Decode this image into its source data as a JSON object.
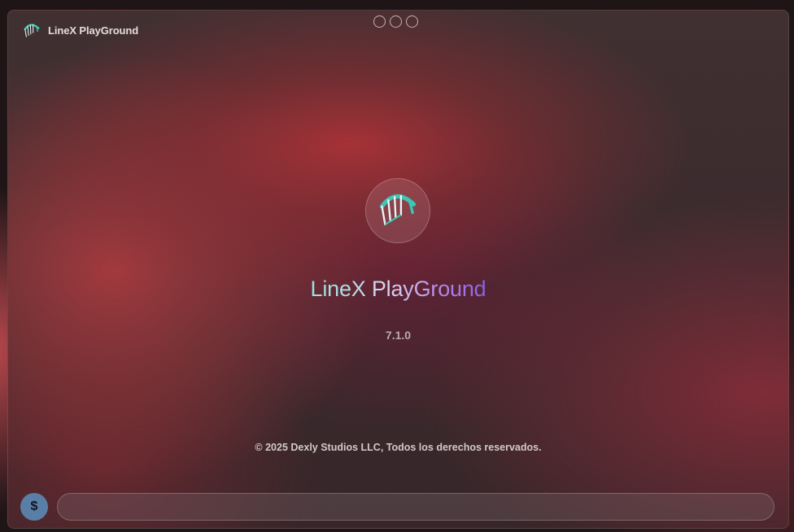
{
  "window": {
    "title": "LineX PlayGround",
    "controls": [
      "minimize",
      "maximize",
      "close"
    ]
  },
  "about": {
    "app_name": "LineX PlayGround",
    "version": "7.1.0",
    "copyright": "© 2025 Dexly Studios LLC, Todos los derechos reservados."
  },
  "bottom_bar": {
    "currency_symbol": "$",
    "input_value": "",
    "input_placeholder": ""
  },
  "icons": {
    "app_logo": "kite-logo-icon",
    "currency": "dollar-icon"
  },
  "colors": {
    "accent_teal": "#3cc6b4",
    "title_gradient_start": "#8fe6dc",
    "title_gradient_end": "#8b5fe0",
    "currency_button": "#5a7fa6"
  }
}
